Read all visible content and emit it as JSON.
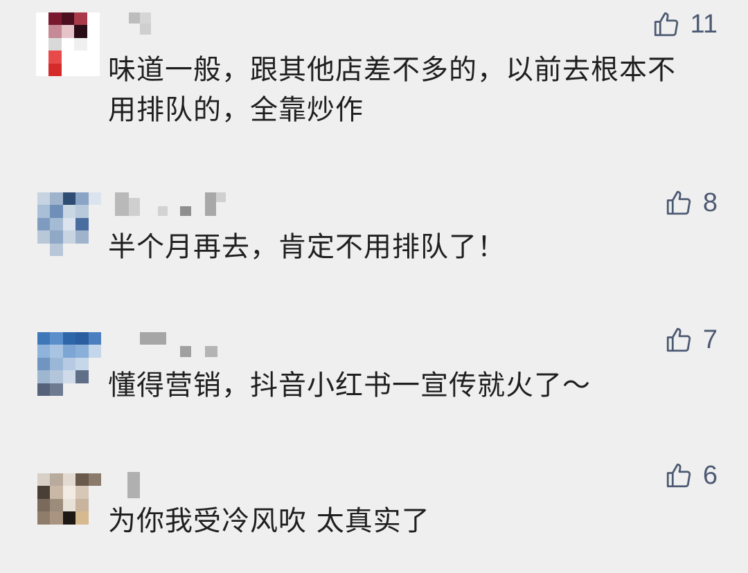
{
  "comments": [
    {
      "text": "味道一般，跟其他店差不多的，以前去根本不用排队的，全靠炒作",
      "likes": "11"
    },
    {
      "text": "半个月再去，肯定不用排队了！",
      "likes": "8"
    },
    {
      "text": "懂得营销，抖音小红书一宣传就火了～",
      "likes": "7"
    },
    {
      "text": "为你我受冷风吹 太真实了",
      "likes": "6"
    }
  ],
  "colors": {
    "background": "#efefef",
    "like_icon": "#4d5a73",
    "text": "#1f1f1f"
  },
  "icons": {
    "like": "thumbs-up-icon"
  }
}
